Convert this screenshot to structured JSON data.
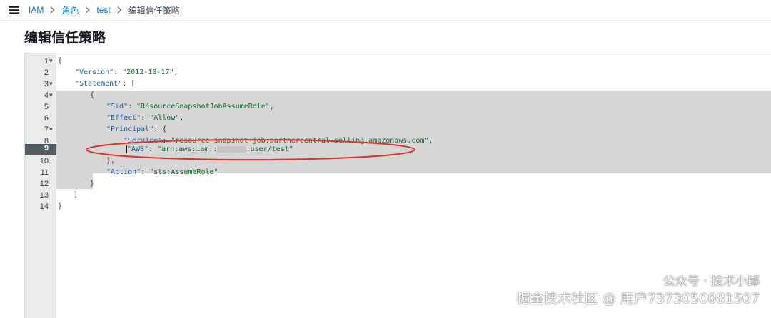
{
  "header": {
    "breadcrumb": {
      "items": [
        "IAM",
        "角色",
        "test"
      ],
      "current": "编辑信任策略"
    }
  },
  "page": {
    "title": "编辑信任策略"
  },
  "editor": {
    "active_line": 9,
    "lines": [
      {
        "n": "1",
        "fold": true
      },
      {
        "n": "2",
        "fold": false
      },
      {
        "n": "3",
        "fold": true
      },
      {
        "n": "4",
        "fold": true
      },
      {
        "n": "5",
        "fold": false
      },
      {
        "n": "6",
        "fold": false
      },
      {
        "n": "7",
        "fold": true
      },
      {
        "n": "8",
        "fold": false
      },
      {
        "n": "9",
        "fold": false
      },
      {
        "n": "10",
        "fold": false
      },
      {
        "n": "11",
        "fold": false
      },
      {
        "n": "12",
        "fold": false
      },
      {
        "n": "13",
        "fold": false
      },
      {
        "n": "14",
        "fold": false
      }
    ],
    "code": {
      "l1": "{",
      "l2_key": "\"Version\"",
      "l2_sep": ": ",
      "l2_val": "\"2012-10-17\"",
      "l2_end": ",",
      "l3_key": "\"Statement\"",
      "l3_rest": ": [",
      "l4": "{",
      "l5_key": "\"Sid\"",
      "l5_sep": ": ",
      "l5_val": "\"ResourceSnapshotJobAssumeRole\"",
      "l5_end": ",",
      "l6_key": "\"Effect\"",
      "l6_sep": ": ",
      "l6_val": "\"Allow\"",
      "l6_end": ",",
      "l7_key": "\"Principal\"",
      "l7_rest": ": {",
      "l8_key": "\"Service\"",
      "l8_sep": ": ",
      "l8_val": "\"resource-snapshot-job.partnercentral-selling.amazonaws.com\"",
      "l8_end": ",",
      "l9_key": "\"AWS\"",
      "l9_sep": ": ",
      "l9_val_a": "\"arn:aws:iam::",
      "l9_val_b": ":user/test\"",
      "l10": "},",
      "l11_key": "\"Action\"",
      "l11_sep": ": ",
      "l11_val": "\"sts:AssumeRole\"",
      "l12": "}",
      "l13": "]",
      "l14": "}"
    }
  },
  "watermark": {
    "line1": "公众号 · 技术小邱",
    "line2": "掘金技术社区 @ 用户7373050081507"
  },
  "colors": {
    "link": "#0972d3",
    "annotation_ellipse": "#e0322a",
    "selection": "#d6d6d6",
    "active_gutter": "#545b64"
  },
  "icons": [
    "menu-icon",
    "chevron-right-icon",
    "fold-arrow-icon",
    "wechat-icon"
  ]
}
